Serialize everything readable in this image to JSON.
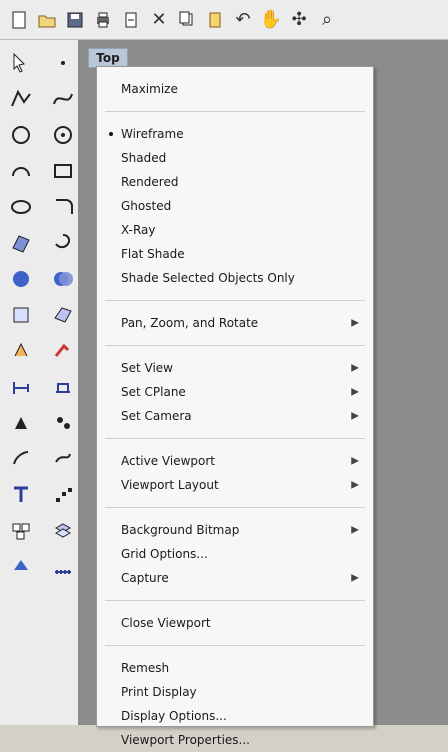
{
  "viewport": {
    "tab_label": "Top"
  },
  "toolbar": {
    "icons": [
      {
        "name": "new-file-icon"
      },
      {
        "name": "open-folder-icon"
      },
      {
        "name": "save-icon"
      },
      {
        "name": "print-icon"
      },
      {
        "name": "import-icon"
      },
      {
        "name": "cut-icon"
      },
      {
        "name": "copy-icon"
      },
      {
        "name": "paste-icon"
      },
      {
        "name": "undo-icon"
      },
      {
        "name": "pan-hand-icon"
      },
      {
        "name": "rotate-view-icon"
      },
      {
        "name": "zoom-icon"
      }
    ]
  },
  "menu": {
    "items": [
      {
        "label": "Maximize",
        "submenu": false,
        "checked": false
      },
      {
        "label": "Wireframe",
        "submenu": false,
        "checked": true
      },
      {
        "label": "Shaded",
        "submenu": false,
        "checked": false
      },
      {
        "label": "Rendered",
        "submenu": false,
        "checked": false
      },
      {
        "label": "Ghosted",
        "submenu": false,
        "checked": false
      },
      {
        "label": "X-Ray",
        "submenu": false,
        "checked": false
      },
      {
        "label": "Flat Shade",
        "submenu": false,
        "checked": false
      },
      {
        "label": "Shade Selected Objects Only",
        "submenu": false,
        "checked": false
      },
      {
        "label": "Pan, Zoom, and Rotate",
        "submenu": true,
        "checked": false
      },
      {
        "label": "Set View",
        "submenu": true,
        "checked": false
      },
      {
        "label": "Set CPlane",
        "submenu": true,
        "checked": false
      },
      {
        "label": "Set Camera",
        "submenu": true,
        "checked": false
      },
      {
        "label": "Active Viewport",
        "submenu": true,
        "checked": false
      },
      {
        "label": "Viewport Layout",
        "submenu": true,
        "checked": false
      },
      {
        "label": "Background Bitmap",
        "submenu": true,
        "checked": false
      },
      {
        "label": "Grid Options...",
        "submenu": false,
        "checked": false
      },
      {
        "label": "Capture",
        "submenu": true,
        "checked": false
      },
      {
        "label": "Close Viewport",
        "submenu": false,
        "checked": false
      },
      {
        "label": "Remesh",
        "submenu": false,
        "checked": false
      },
      {
        "label": "Print Display",
        "submenu": false,
        "checked": false
      },
      {
        "label": "Display Options...",
        "submenu": false,
        "checked": false
      },
      {
        "label": "Viewport Properties...",
        "submenu": false,
        "checked": false
      }
    ]
  },
  "left_tools": {
    "icons": [
      {
        "name": "select-arrow-icon"
      },
      {
        "name": "point-icon"
      },
      {
        "name": "polyline-icon"
      },
      {
        "name": "curve-icon"
      },
      {
        "name": "circle-icon"
      },
      {
        "name": "circle-center-icon"
      },
      {
        "name": "arc-icon"
      },
      {
        "name": "rectangle-icon"
      },
      {
        "name": "ellipse-icon"
      },
      {
        "name": "fillet-icon"
      },
      {
        "name": "surface-icon"
      },
      {
        "name": "revolve-icon"
      },
      {
        "name": "solid-icon"
      },
      {
        "name": "boolean-icon"
      },
      {
        "name": "box-icon"
      },
      {
        "name": "mesh-icon"
      },
      {
        "name": "transform-icon"
      },
      {
        "name": "array-icon"
      },
      {
        "name": "dimension-icon"
      },
      {
        "name": "annotation-icon"
      },
      {
        "name": "analyze-icon"
      },
      {
        "name": "render-icon"
      },
      {
        "name": "history-icon"
      },
      {
        "name": "blend-icon"
      },
      {
        "name": "text-icon"
      },
      {
        "name": "point-cloud-icon"
      },
      {
        "name": "group-icon"
      },
      {
        "name": "layer-icon"
      },
      {
        "name": "block-icon"
      },
      {
        "name": "grid-icon"
      }
    ]
  }
}
